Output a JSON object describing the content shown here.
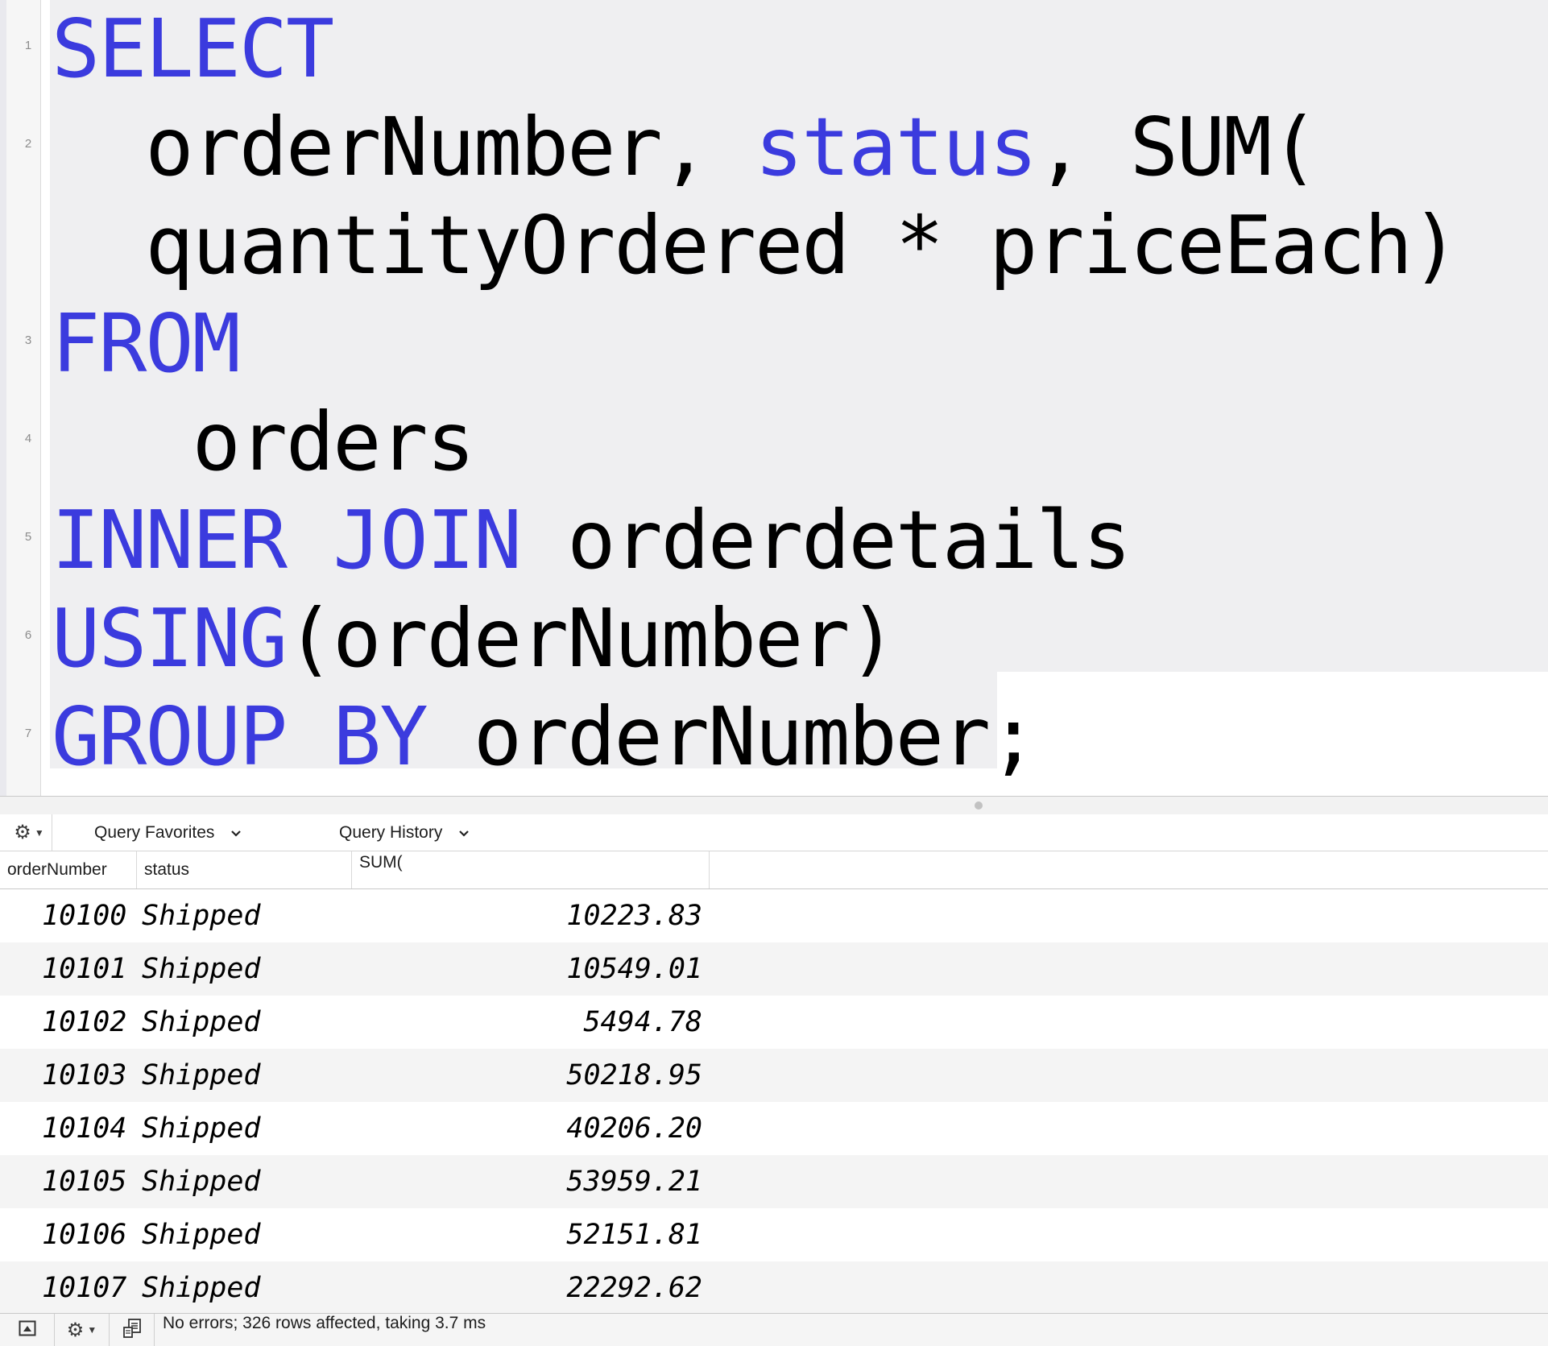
{
  "editor": {
    "line_numbers": [
      "1",
      "2",
      "3",
      "4",
      "5",
      "6",
      "7"
    ],
    "lines": [
      {
        "tokens": [
          {
            "text": "SELECT",
            "kw": true
          }
        ]
      },
      {
        "tokens": [
          {
            "text": "  orderNumber, ",
            "kw": false
          },
          {
            "text": "status",
            "kw": true
          },
          {
            "text": ", SUM(",
            "kw": false
          }
        ]
      },
      {
        "tokens": [
          {
            "text": "  quantityOrdered * priceEach)",
            "kw": false
          }
        ]
      },
      {
        "tokens": [
          {
            "text": "FROM",
            "kw": true
          }
        ]
      },
      {
        "tokens": [
          {
            "text": "   orders",
            "kw": false
          }
        ]
      },
      {
        "tokens": [
          {
            "text": "INNER",
            "kw": true
          },
          {
            "text": " ",
            "kw": false
          },
          {
            "text": "JOIN",
            "kw": true
          },
          {
            "text": " orderdetails",
            "kw": false
          }
        ]
      },
      {
        "tokens": [
          {
            "text": "USING",
            "kw": true
          },
          {
            "text": "(orderNumber)",
            "kw": false
          }
        ]
      },
      {
        "tokens": [
          {
            "text": "GROUP",
            "kw": true
          },
          {
            "text": " ",
            "kw": false
          },
          {
            "text": "BY",
            "kw": true
          },
          {
            "text": " orderNumber;",
            "kw": false
          }
        ]
      }
    ],
    "colors": {
      "keyword": "#3b3bde",
      "text": "#000000",
      "selection": "#efeff1"
    }
  },
  "toolbar": {
    "gear_icon": "gear-icon",
    "query_favorites_label": "Query Favorites",
    "query_history_label": "Query History"
  },
  "results": {
    "columns": [
      "orderNumber",
      "status",
      "SUM("
    ],
    "rows": [
      {
        "orderNumber": "10100",
        "status": "Shipped",
        "sum": "10223.83"
      },
      {
        "orderNumber": "10101",
        "status": "Shipped",
        "sum": "10549.01"
      },
      {
        "orderNumber": "10102",
        "status": "Shipped",
        "sum": "5494.78"
      },
      {
        "orderNumber": "10103",
        "status": "Shipped",
        "sum": "50218.95"
      },
      {
        "orderNumber": "10104",
        "status": "Shipped",
        "sum": "40206.20"
      },
      {
        "orderNumber": "10105",
        "status": "Shipped",
        "sum": "53959.21"
      },
      {
        "orderNumber": "10106",
        "status": "Shipped",
        "sum": "52151.81"
      },
      {
        "orderNumber": "10107",
        "status": "Shipped",
        "sum": "22292.62"
      }
    ]
  },
  "status_bar": {
    "message": "No errors; 326 rows affected, taking 3.7 ms",
    "icons": [
      "toggle-panel-icon",
      "gear-icon",
      "query-log-icon"
    ]
  }
}
